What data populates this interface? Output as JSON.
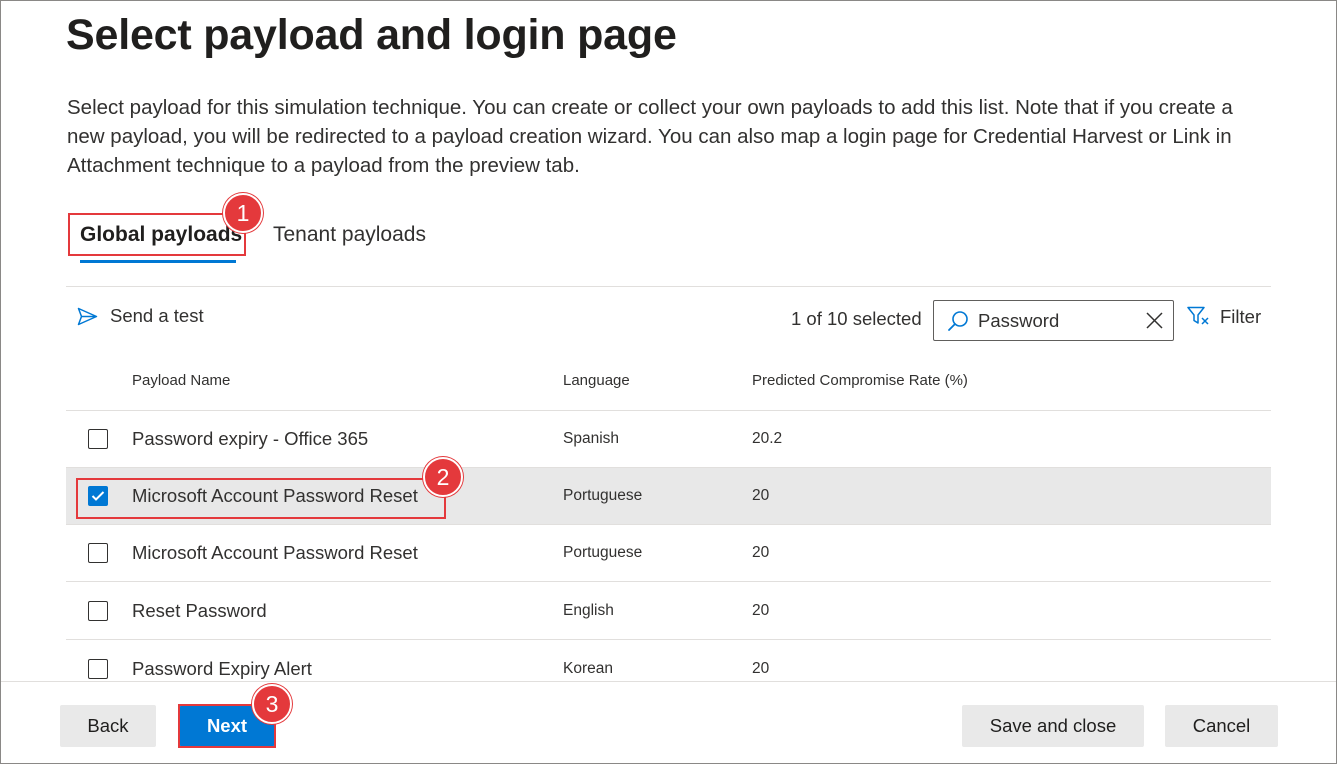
{
  "page": {
    "title": "Select payload and login page",
    "description": "Select payload for this simulation technique. You can create or collect your own payloads to add this list. Note that if you create a new payload, you will be redirected to a payload creation wizard. You can also map a login page for Credential Harvest or Link in Attachment technique to a payload from the preview tab."
  },
  "tabs": [
    {
      "label": "Global payloads",
      "active": true
    },
    {
      "label": "Tenant payloads",
      "active": false
    }
  ],
  "toolbar": {
    "send_test_label": "Send a test",
    "selected_count": "1 of 10 selected",
    "search_value": "Password",
    "filter_label": "Filter"
  },
  "table": {
    "columns": [
      "Payload Name",
      "Language",
      "Predicted Compromise Rate (%)"
    ],
    "rows": [
      {
        "name": "Password expiry - Office 365",
        "language": "Spanish",
        "rate": "20.2",
        "checked": false
      },
      {
        "name": "Microsoft Account Password Reset",
        "language": "Portuguese",
        "rate": "20",
        "checked": true
      },
      {
        "name": "Microsoft Account Password Reset",
        "language": "Portuguese",
        "rate": "20",
        "checked": false
      },
      {
        "name": "Reset Password",
        "language": "English",
        "rate": "20",
        "checked": false
      },
      {
        "name": "Password Expiry Alert",
        "language": "Korean",
        "rate": "20",
        "checked": false
      }
    ]
  },
  "footer": {
    "back_label": "Back",
    "next_label": "Next",
    "save_close_label": "Save and close",
    "cancel_label": "Cancel"
  },
  "annotations": [
    "1",
    "2",
    "3"
  ],
  "colors": {
    "accent": "#0078d4",
    "highlight": "#e4393c",
    "selected_row": "#e8e8e8"
  }
}
